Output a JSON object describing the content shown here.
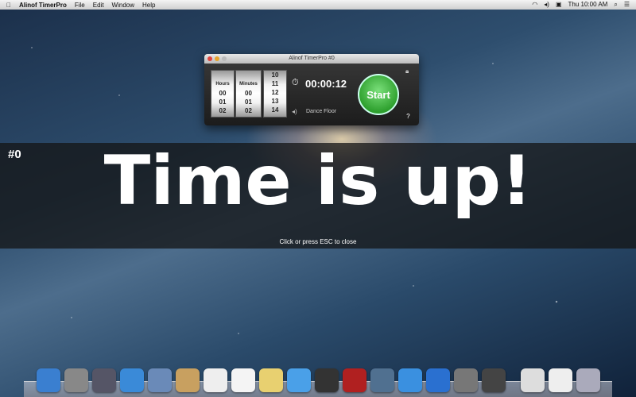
{
  "menubar": {
    "app": "Alinof TimerPro",
    "items": [
      "File",
      "Edit",
      "Window",
      "Help"
    ],
    "clock": "Thu 10:00 AM"
  },
  "window": {
    "title": "Alinof TimerPro #0",
    "hours_label": "Hours",
    "minutes_label": "Minutes",
    "hours": [
      "00",
      "01",
      "02"
    ],
    "minutes": [
      "00",
      "01",
      "02"
    ],
    "seconds": [
      "10",
      "11",
      "12",
      "13",
      "14"
    ],
    "time": "00:00:12",
    "sound": "Dance Floor",
    "start_label": "Start",
    "help": "?"
  },
  "alert": {
    "timer_id": "#0",
    "message": "Time is up!",
    "hint": "Click or press ESC to close"
  },
  "dock": {
    "icons": [
      "finder",
      "launchpad",
      "mission-control",
      "safari",
      "mail",
      "contacts",
      "calendar",
      "reminders",
      "notes",
      "messages",
      "facetime",
      "photo-booth",
      "iphoto",
      "itunes",
      "app-store",
      "system-preferences",
      "timerpro",
      "preview",
      "downloads",
      "trash"
    ],
    "colors": [
      "#3a7fd0",
      "#888",
      "#556",
      "#3a8ad8",
      "#6a8ab8",
      "#c8a060",
      "#eee",
      "#f4f4f4",
      "#e8d070",
      "#4aa0e8",
      "#333",
      "#b02020",
      "#507090",
      "#3a90e0",
      "#2a70d0",
      "#777",
      "#444",
      "#ddd",
      "#eee",
      "#aab"
    ]
  }
}
